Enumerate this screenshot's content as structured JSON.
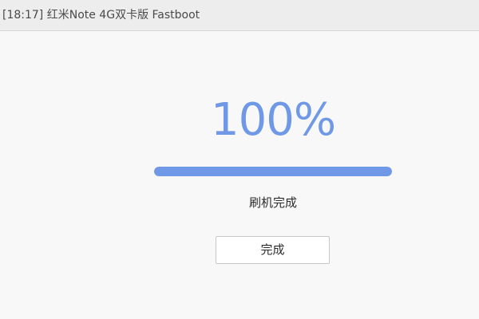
{
  "window": {
    "title": "[18:17]  红米Note 4G双卡版  Fastboot"
  },
  "flash": {
    "percent_label": "100%",
    "progress": 1.0,
    "status": "刷机完成",
    "done_button_label": "完成"
  },
  "colors": {
    "accent": "#6f98e6",
    "titlebar_bg": "#ededed",
    "content_bg": "#f8f8f8"
  }
}
